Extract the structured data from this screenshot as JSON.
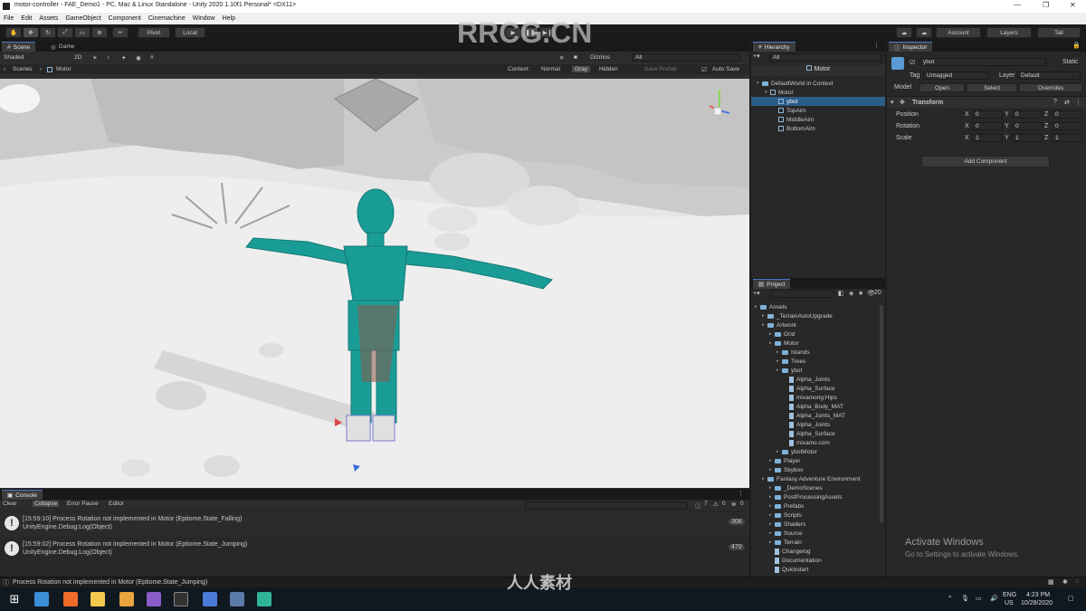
{
  "window": {
    "title": "motor-controller - FAE_Demo1 - PC, Mac & Linux Standalone - Unity 2020.1.10f1 Personal* <DX11>",
    "minimize": "—",
    "maximize": "❐",
    "close": "✕"
  },
  "menu": [
    "File",
    "Edit",
    "Assets",
    "GameObject",
    "Component",
    "Cinemachine",
    "Window",
    "Help"
  ],
  "toolbar": {
    "pivot": "Pivot",
    "local": "Local",
    "account": "Account",
    "layers": "Layers",
    "layout": "Tall"
  },
  "scene": {
    "tabs": [
      "Scene",
      "Game"
    ],
    "shading": "Shaded",
    "mode_2d": "2D",
    "gizmos": "Gizmos",
    "search_placeholder": "All",
    "breadcrumb_root": "Scenes",
    "breadcrumb_item": "Motor",
    "context_label": "Context:",
    "context_options": [
      "Normal",
      "Gray",
      "Hidden"
    ],
    "save_button": "Save Prefab",
    "autosave": "Auto Save"
  },
  "hierarchy": {
    "tab": "Hierarchy",
    "search_placeholder": "All",
    "header": "Motor",
    "items": [
      {
        "label": "DefaultWorld in Context",
        "depth": 0,
        "type": "folder"
      },
      {
        "label": "Motor",
        "depth": 1,
        "type": "cube"
      },
      {
        "label": "ybot",
        "depth": 2,
        "type": "cube",
        "selected": true
      },
      {
        "label": "TopAim",
        "depth": 2,
        "type": "cube"
      },
      {
        "label": "MiddleAim",
        "depth": 2,
        "type": "cube"
      },
      {
        "label": "BottomAim",
        "depth": 2,
        "type": "cube"
      }
    ]
  },
  "project": {
    "tab": "Project",
    "count_badge": "20",
    "items": [
      {
        "label": "Assets",
        "depth": 0,
        "type": "folder"
      },
      {
        "label": "_TerrainAutoUpgrade",
        "depth": 1,
        "type": "folder"
      },
      {
        "label": "Artwork",
        "depth": 1,
        "type": "folder"
      },
      {
        "label": "Grid",
        "depth": 2,
        "type": "folder"
      },
      {
        "label": "Motor",
        "depth": 2,
        "type": "folder"
      },
      {
        "label": "Islands",
        "depth": 3,
        "type": "folder"
      },
      {
        "label": "Trees",
        "depth": 3,
        "type": "folder"
      },
      {
        "label": "ybot",
        "depth": 3,
        "type": "folder"
      },
      {
        "label": "Alpha_Joints",
        "depth": 4,
        "type": "file"
      },
      {
        "label": "Alpha_Surface",
        "depth": 4,
        "type": "file"
      },
      {
        "label": "mixamorig:Hips",
        "depth": 4,
        "type": "file"
      },
      {
        "label": "Alpha_Body_MAT",
        "depth": 4,
        "type": "file"
      },
      {
        "label": "Alpha_Joints_MAT",
        "depth": 4,
        "type": "file"
      },
      {
        "label": "Alpha_Joints",
        "depth": 4,
        "type": "file"
      },
      {
        "label": "Alpha_Surface",
        "depth": 4,
        "type": "file"
      },
      {
        "label": "mixamo.com",
        "depth": 4,
        "type": "file"
      },
      {
        "label": "ybotMotor",
        "depth": 3,
        "type": "folder"
      },
      {
        "label": "Player",
        "depth": 2,
        "type": "folder"
      },
      {
        "label": "Skybox",
        "depth": 2,
        "type": "folder"
      },
      {
        "label": "Fantasy Adventure Environment",
        "depth": 1,
        "type": "folder"
      },
      {
        "label": "_DemoScenes",
        "depth": 2,
        "type": "folder"
      },
      {
        "label": "PostProcessingAssets",
        "depth": 2,
        "type": "folder"
      },
      {
        "label": "Prefabs",
        "depth": 2,
        "type": "folder"
      },
      {
        "label": "Scripts",
        "depth": 2,
        "type": "folder"
      },
      {
        "label": "Shaders",
        "depth": 2,
        "type": "folder"
      },
      {
        "label": "Source",
        "depth": 2,
        "type": "folder"
      },
      {
        "label": "Terrain",
        "depth": 2,
        "type": "folder"
      },
      {
        "label": "Changelog",
        "depth": 2,
        "type": "file"
      },
      {
        "label": "Documentation",
        "depth": 2,
        "type": "file"
      },
      {
        "label": "Quickstart",
        "depth": 2,
        "type": "file"
      }
    ]
  },
  "inspector": {
    "tab": "Inspector",
    "object_name": "ybot",
    "static": "Static",
    "tag_label": "Tag",
    "tag_value": "Untagged",
    "layer_label": "Layer",
    "layer_value": "Default",
    "model_label": "Model",
    "open": "Open",
    "select": "Select",
    "overrides": "Overrides",
    "component": "Transform",
    "rows": [
      {
        "label": "Position",
        "x": "0",
        "y": "0",
        "z": "0"
      },
      {
        "label": "Rotation",
        "x": "0",
        "y": "0",
        "z": "0"
      },
      {
        "label": "Scale",
        "x": "1",
        "y": "1",
        "z": "1"
      }
    ],
    "add_component": "Add Component",
    "activate_title": "Activate Windows",
    "activate_sub": "Go to Settings to activate Windows."
  },
  "console": {
    "tab": "Console",
    "buttons": [
      "Clear",
      "Collapse",
      "Error Pause",
      "Editor"
    ],
    "counts": {
      "info": "7",
      "warn": "0",
      "error": "0"
    },
    "messages": [
      {
        "line1": "[15:59:10] Process Rotation not implemented in Motor (Eptiome.State_Falling)",
        "line2": "UnityEngine.Debug:Log(Object)",
        "count": "308"
      },
      {
        "line1": "[15:59:02] Process Rotation not implemented in Motor (Eptiome.State_Jumping)",
        "line2": "UnityEngine.Debug:Log(Object)",
        "count": "470"
      }
    ]
  },
  "status": {
    "text": "Process Rotation not implemented in Motor (Eptiome.State_Jumping)"
  },
  "taskbar": {
    "lang": "ENG",
    "region": "US",
    "time": "4:23 PM",
    "date": "10/28/2020"
  },
  "watermarks": {
    "top": "RRCG.CN",
    "bottom": "人人素材"
  },
  "colors": {
    "accent": "#2c5d87",
    "character": "#1a9c96",
    "panel": "#282828"
  }
}
